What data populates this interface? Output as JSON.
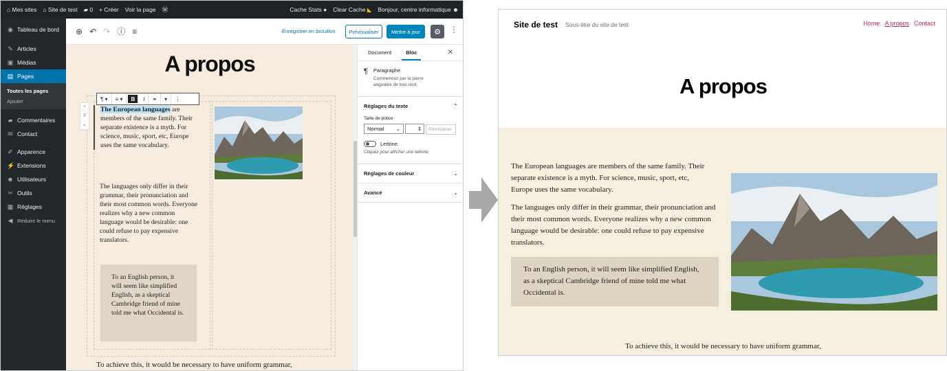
{
  "admin_bar": {
    "my_sites": "Mes sites",
    "site_name": "Site de test",
    "comments_count": "0",
    "new": "+ Créer",
    "view_page": "Voir la page",
    "cache_stats": "Cache Stats",
    "clear_cache": "Clear Cache",
    "greeting": "Bonjour, centre informatique"
  },
  "sidebar": {
    "items": [
      {
        "label": "Tableau de bord",
        "icon": "dashboard-icon",
        "glyph": "◉"
      },
      {
        "label": "Articles",
        "icon": "pin-icon",
        "glyph": "✎"
      },
      {
        "label": "Médias",
        "icon": "media-icon",
        "glyph": "▣"
      },
      {
        "label": "Pages",
        "icon": "pages-icon",
        "glyph": "▤"
      },
      {
        "label": "Commentaires",
        "icon": "comment-icon",
        "glyph": "▰"
      },
      {
        "label": "Contact",
        "icon": "mail-icon",
        "glyph": "✉"
      },
      {
        "label": "Apparence",
        "icon": "brush-icon",
        "glyph": "✐"
      },
      {
        "label": "Extensions",
        "icon": "plugin-icon",
        "glyph": "⚡"
      },
      {
        "label": "Utilisateurs",
        "icon": "users-icon",
        "glyph": "☻"
      },
      {
        "label": "Outils",
        "icon": "wrench-icon",
        "glyph": "✂"
      },
      {
        "label": "Réglages",
        "icon": "settings-icon",
        "glyph": "▦"
      },
      {
        "label": "Réduire le menu",
        "icon": "collapse-icon",
        "glyph": "◀"
      }
    ],
    "submenu": [
      "Toutes les pages",
      "Ajouter"
    ]
  },
  "toolbar": {
    "save_draft": "Enregistrer en brouillon",
    "preview": "Prévisualiser",
    "update": "Mettre à jour"
  },
  "editor": {
    "title": "A propos",
    "para1_highlight": "The European languages",
    "para1_rest": " are members of the same family. Their separate existence is a myth. For science, music, sport, etc, Europe uses the same vocabulary.",
    "para2": "The languages only differ in their grammar, their pronunciation and their most common words. Everyone realizes why a new common language would be desirable: one could refuse to pay expensive translators.",
    "quote": "To an English person, it will seem like simplified English, as a skeptical Cambridge friend of mine told me what Occidental is.",
    "bottom": "To achieve this, it would be necessary to have uniform grammar,"
  },
  "panel": {
    "tab_document": "Document",
    "tab_block": "Bloc",
    "block_name": "Paragraphe",
    "block_desc": "Commencez par la pierre angulaire de tout récit.",
    "text_settings": "Réglages du texte",
    "font_size_label": "Taille de police",
    "font_size_value": "Normal",
    "reset": "Réinitialiser",
    "dropcap": "Lettrine",
    "dropcap_help": "Cliquez pour afficher une lettrine.",
    "color_settings": "Réglages de couleur",
    "advanced": "Avancé"
  },
  "site": {
    "title": "Site de test",
    "tagline": "Sous-titre du site de test",
    "nav": [
      "Home",
      "A propos",
      "Contact"
    ],
    "h1": "A propos",
    "para1": "The European languages are members of the same family. Their separate existence is a myth. For science, music, sport, etc, Europe uses the same vocabulary.",
    "para2": "The languages only differ in their grammar, their pronunciation and their most common words. Everyone realizes why a new common language would be desirable: one could refuse to pay expensive translators.",
    "quote": "To an English person, it will seem like simplified English, as a skeptical Cambridge friend of mine told me what Occidental is.",
    "bottom": "To achieve this, it would be necessary to have uniform grammar,"
  },
  "colors": {
    "accent": "#cd2653",
    "wp_blue": "#0073aa",
    "admin_dark": "#23282d",
    "cream": "#f5ecdf"
  }
}
